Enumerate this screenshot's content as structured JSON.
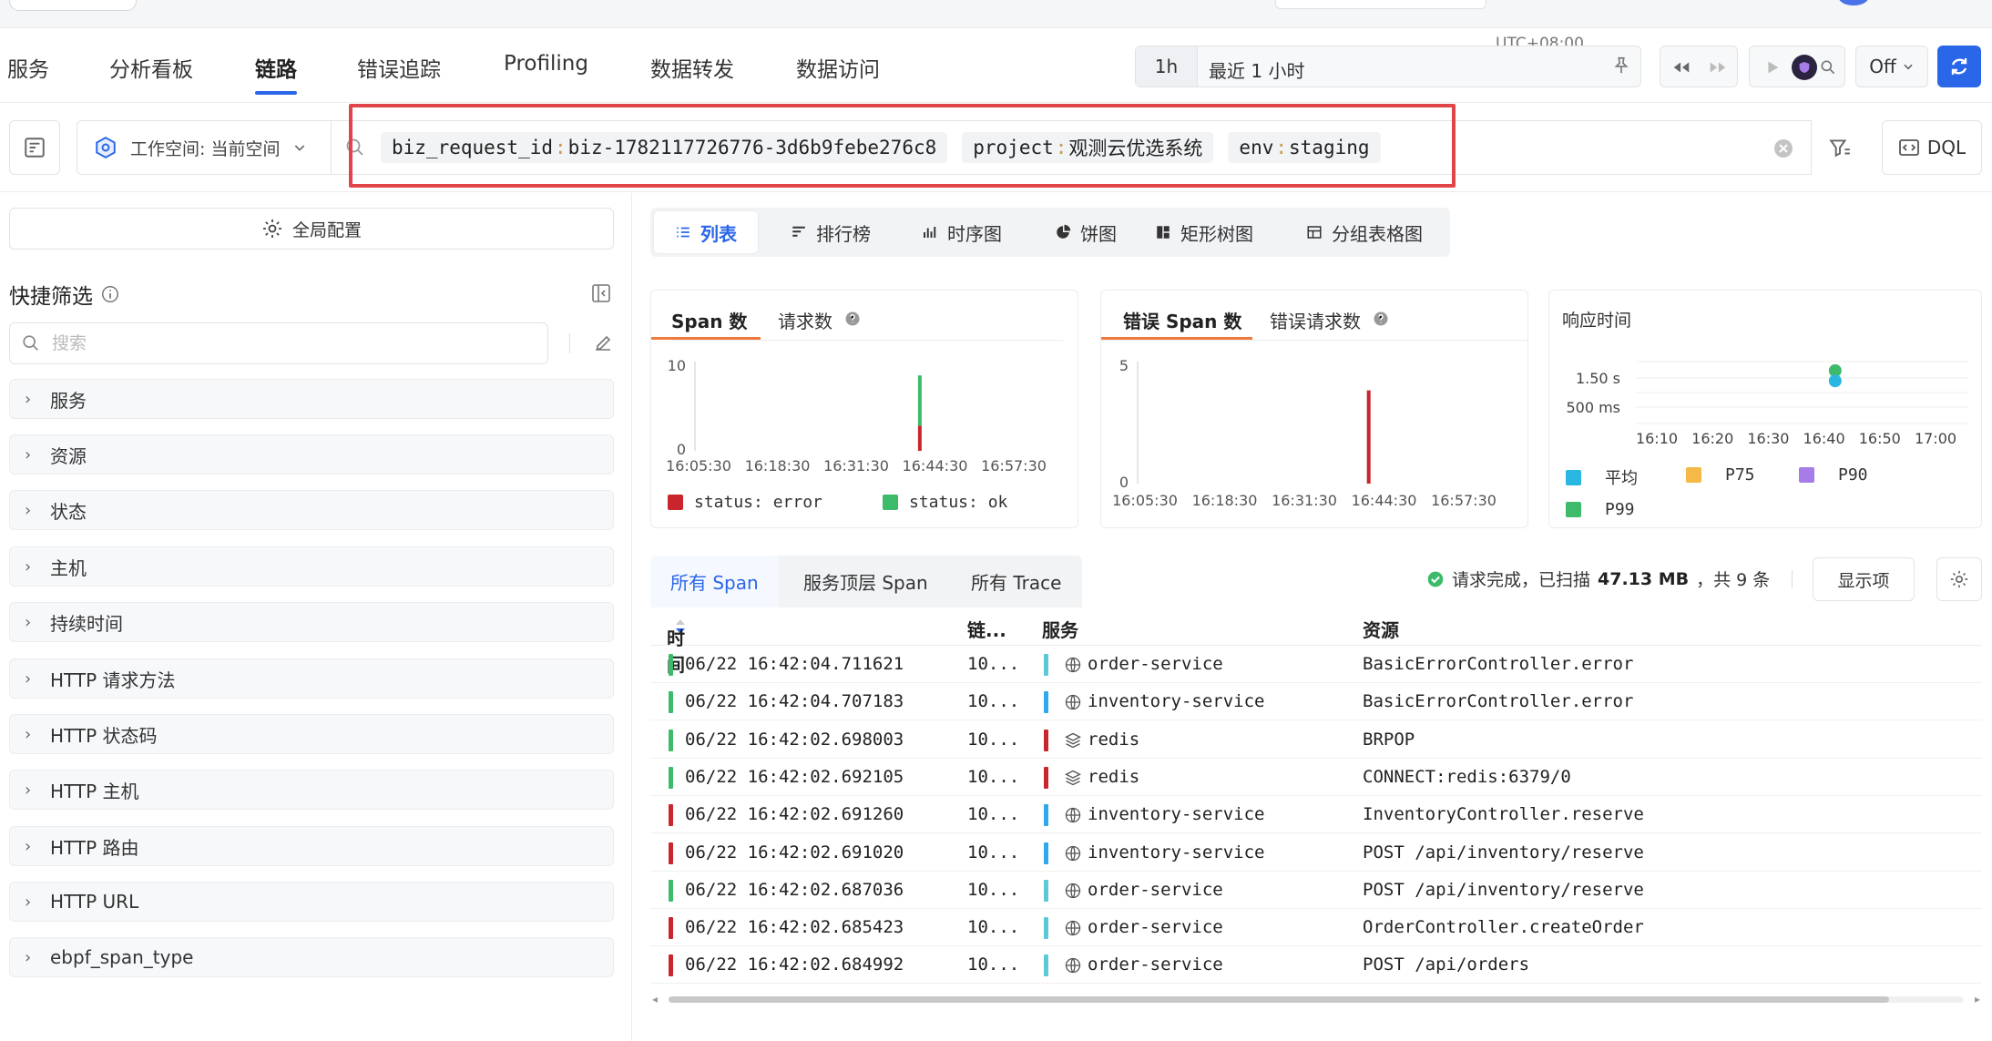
{
  "nav": {
    "tabs": [
      {
        "label": "服务"
      },
      {
        "label": "分析看板"
      },
      {
        "label": "链路"
      },
      {
        "label": "错误追踪"
      },
      {
        "label": "Profiling"
      },
      {
        "label": "数据转发"
      },
      {
        "label": "数据访问"
      }
    ],
    "active_tab": "链路"
  },
  "time": {
    "timezone": "UTC+08:00",
    "duration": "1h",
    "range_label": "最近 1 小时",
    "auto_refresh": "Off"
  },
  "filter": {
    "workspace_label": "工作空间: 当前空间",
    "chips": [
      {
        "key": "biz_request_id",
        "sep": ":",
        "value": "biz-1782117726776-3d6b9febe276c8"
      },
      {
        "key": "project",
        "sep": ":",
        "value": "观测云优选系统"
      },
      {
        "key": "env",
        "sep": ":",
        "value": "staging"
      }
    ],
    "dql_label": "DQL"
  },
  "sidebar": {
    "global_config": "全局配置",
    "quick_filter_title": "快捷筛选",
    "search_placeholder": "搜索",
    "facets": [
      "服务",
      "资源",
      "状态",
      "主机",
      "持续时间",
      "HTTP 请求方法",
      "HTTP 状态码",
      "HTTP 主机",
      "HTTP 路由",
      "HTTP URL",
      "ebpf_span_type"
    ]
  },
  "viz_tabs": [
    "列表",
    "排行榜",
    "时序图",
    "饼图",
    "矩形树图",
    "分组表格图"
  ],
  "charts": {
    "span": {
      "tab_active": "Span 数",
      "tab_other": "请求数",
      "legend": [
        "status: error",
        "status: ok"
      ]
    },
    "error_span": {
      "tab_active": "错误 Span 数",
      "tab_other": "错误请求数"
    },
    "latency": {
      "title": "响应时间",
      "legend": [
        "平均",
        "P75",
        "P90",
        "P99"
      ]
    }
  },
  "chart_data": [
    {
      "type": "bar",
      "x_ticks": [
        "16:05:30",
        "16:18:30",
        "16:31:30",
        "16:44:30",
        "16:57:30"
      ],
      "y_ticks": [
        "0",
        "10"
      ],
      "ylim": [
        0,
        10
      ],
      "series": [
        {
          "name": "status: error",
          "color": "#c8262c",
          "x": "16:42:00",
          "values": [
            3
          ]
        },
        {
          "name": "status: ok",
          "color": "#3dba6a",
          "x": "16:42:00",
          "values": [
            6
          ]
        }
      ]
    },
    {
      "type": "bar",
      "x_ticks": [
        "16:05:30",
        "16:18:30",
        "16:31:30",
        "16:44:30",
        "16:57:30"
      ],
      "y_ticks": [
        "0",
        "5"
      ],
      "ylim": [
        0,
        5
      ],
      "series": [
        {
          "color": "#c8262c",
          "x": "16:42:00",
          "values": [
            4
          ]
        }
      ]
    },
    {
      "type": "scatter",
      "x_ticks": [
        "16:10",
        "16:20",
        "16:30",
        "16:40",
        "16:50",
        "17:00"
      ],
      "y_ticks": [
        "500 ms",
        "1.50 s"
      ],
      "series": [
        {
          "name": "P99",
          "color": "#3dba6a",
          "x": "16:42",
          "values": [
            1.75
          ]
        },
        {
          "name": "平均",
          "color": "#29b6e0",
          "x": "16:42",
          "values": [
            1.4
          ]
        }
      ]
    }
  ],
  "legend_colors": {
    "error": "#c8262c",
    "ok": "#3dba6a",
    "avg": "#29b6e0",
    "p75": "#f5b947",
    "p90": "#a77ce8",
    "p99": "#3dba6a"
  },
  "table": {
    "tabs": [
      "所有 Span",
      "服务顶层 Span",
      "所有 Trace"
    ],
    "status_prefix": "请求完成，已扫描",
    "scanned": "47.13 MB",
    "count_text": "，共 9 条",
    "columns_button": "显示项",
    "headers": {
      "time": "时间",
      "trace": "链...",
      "service": "服务",
      "resource": "资源"
    },
    "rows": [
      {
        "time": "06/22 16:42:04.711621",
        "trace": "10...",
        "service": "order-service",
        "resource": "BasicErrorController.error",
        "status": "ok",
        "svc_color": "#5cc8d8",
        "svc_icon": "globe-icon"
      },
      {
        "time": "06/22 16:42:04.707183",
        "trace": "10...",
        "service": "inventory-service",
        "resource": "BasicErrorController.error",
        "status": "ok",
        "svc_color": "#2ea8e8",
        "svc_icon": "globe-icon"
      },
      {
        "time": "06/22 16:42:02.698003",
        "trace": "10...",
        "service": "redis",
        "resource": "BRPOP",
        "status": "ok",
        "svc_color": "#c8262c",
        "svc_icon": "layers-icon"
      },
      {
        "time": "06/22 16:42:02.692105",
        "trace": "10...",
        "service": "redis",
        "resource": "CONNECT:redis:6379/0",
        "status": "ok",
        "svc_color": "#c8262c",
        "svc_icon": "layers-icon"
      },
      {
        "time": "06/22 16:42:02.691260",
        "trace": "10...",
        "service": "inventory-service",
        "resource": "InventoryController.reserve",
        "status": "error",
        "svc_color": "#2ea8e8",
        "svc_icon": "globe-icon"
      },
      {
        "time": "06/22 16:42:02.691020",
        "trace": "10...",
        "service": "inventory-service",
        "resource": "POST /api/inventory/reserve",
        "status": "error",
        "svc_color": "#2ea8e8",
        "svc_icon": "globe-icon"
      },
      {
        "time": "06/22 16:42:02.687036",
        "trace": "10...",
        "service": "order-service",
        "resource": "POST /api/inventory/reserve",
        "status": "ok",
        "svc_color": "#5cc8d8",
        "svc_icon": "globe-icon"
      },
      {
        "time": "06/22 16:42:02.685423",
        "trace": "10...",
        "service": "order-service",
        "resource": "OrderController.createOrder",
        "status": "error",
        "svc_color": "#5cc8d8",
        "svc_icon": "globe-icon"
      },
      {
        "time": "06/22 16:42:02.684992",
        "trace": "10...",
        "service": "order-service",
        "resource": "POST /api/orders",
        "status": "error",
        "svc_color": "#5cc8d8",
        "svc_icon": "globe-icon"
      }
    ]
  }
}
